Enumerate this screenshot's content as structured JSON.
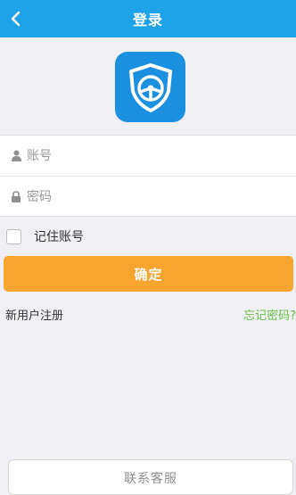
{
  "header": {
    "title": "登录",
    "back_icon": "chevron-left-icon"
  },
  "logo": {
    "icon": "shield-steering-wheel-icon",
    "color": "#1b8fe0"
  },
  "form": {
    "account": {
      "placeholder": "账号",
      "value": "",
      "icon": "user-icon"
    },
    "password": {
      "placeholder": "密码",
      "value": "",
      "icon": "lock-icon"
    },
    "remember_label": "记住账号",
    "remember_checked": false,
    "confirm_label": "确定"
  },
  "links": {
    "register": "新用户注册",
    "forgot": "忘记密码?"
  },
  "footer": {
    "service_label": "联系客服"
  },
  "colors": {
    "header_bg": "#1ea2ea",
    "confirm_bg": "#f8a42e",
    "forgot_link": "#6abd45",
    "page_bg": "#efeff4"
  }
}
